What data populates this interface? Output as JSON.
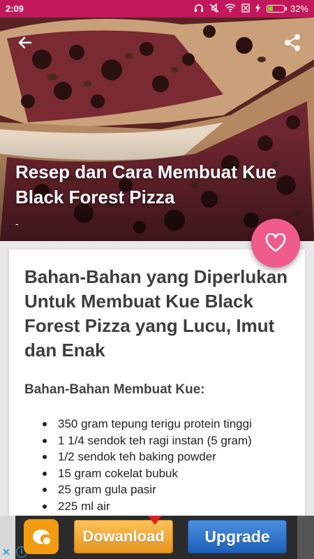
{
  "status_bar": {
    "time": "2:09",
    "battery_percent": "32%",
    "battery_level": 0.32,
    "icons": [
      "headphones-icon",
      "mute-icon",
      "wifi-icon",
      "sim-icon",
      "charging-icon",
      "battery-icon"
    ]
  },
  "hero": {
    "title": "Resep dan Cara Membuat Kue Black Forest Pizza",
    "subtitle": "-",
    "back_icon": "arrow-left-icon",
    "share_icon": "share-icon"
  },
  "favorite": {
    "icon": "heart-outline-icon",
    "color": "#ef5b8a"
  },
  "article": {
    "title": "Bahan-Bahan yang Diperlukan Untuk Membuat Kue Black Forest Pizza yang Lucu, Imut dan Enak",
    "section_title": "Bahan-Bahan Membuat Kue:",
    "ingredients": [
      "350 gram tepung terigu protein tinggi",
      "1 1/4 sendok teh ragi instan (5 gram)",
      "1/2 sendok teh baking powder",
      "15 gram cokelat bubuk",
      "25 gram gula pasir",
      "225 ml air"
    ]
  },
  "ad": {
    "download_label": "Dowanload",
    "upgrade_label": "Upgrade",
    "close_icon": "close-icon",
    "info_icon": "info-icon",
    "logo_icon": "uc-browser-logo-icon"
  },
  "colors": {
    "status_bar": "#c2185b",
    "accent": "#ef5b8a",
    "download": "#f0a030",
    "upgrade": "#2f78d0"
  }
}
